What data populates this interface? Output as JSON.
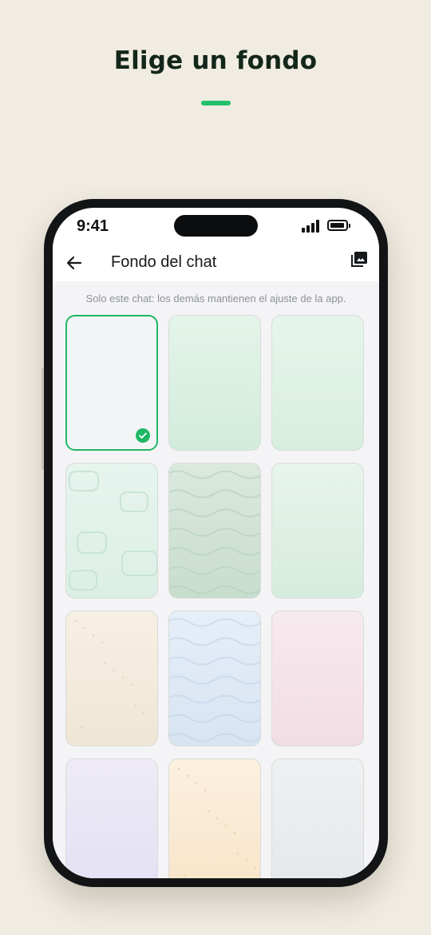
{
  "page": {
    "headline": "Elige un fondo",
    "accent_color": "#22c06b"
  },
  "status_bar": {
    "time": "9:41",
    "signal_icon": "signal-bars-icon",
    "battery_icon": "battery-icon"
  },
  "app_bar": {
    "back_icon": "back-arrow-icon",
    "title": "Fondo del chat",
    "gallery_icon": "photo-library-icon"
  },
  "hint": "Solo este chat: los demás mantienen el ajuste de la app.",
  "wallpapers": [
    {
      "id": "default",
      "style": "plain",
      "selected": true,
      "colors": [
        "#f3f4f6",
        "#f3f4f6"
      ]
    },
    {
      "id": "mint-gradient",
      "style": "gradient",
      "selected": false,
      "colors": [
        "#e4f4ea",
        "#d2ecdc"
      ]
    },
    {
      "id": "mint-light",
      "style": "gradient",
      "selected": false,
      "colors": [
        "#e6f5ec",
        "#d8eedf"
      ]
    },
    {
      "id": "mint-bubbles",
      "style": "bubbles",
      "selected": false,
      "colors": [
        "#e6f4ee",
        "#dcefe5"
      ]
    },
    {
      "id": "sage-waves",
      "style": "waves",
      "selected": false,
      "colors": [
        "#dbe9df",
        "#c8ddcd"
      ]
    },
    {
      "id": "mint-soft",
      "style": "gradient",
      "selected": false,
      "colors": [
        "#e7f4ec",
        "#d6ecdd"
      ]
    },
    {
      "id": "sand-dots",
      "style": "dots",
      "selected": false,
      "colors": [
        "#f7efe4",
        "#f0e6d6"
      ]
    },
    {
      "id": "sky-waves",
      "style": "waves",
      "selected": false,
      "colors": [
        "#e6eef8",
        "#d7e4f2"
      ]
    },
    {
      "id": "blush",
      "style": "gradient",
      "selected": false,
      "colors": [
        "#f7eaee",
        "#f1dde3"
      ]
    },
    {
      "id": "lavender",
      "style": "gradient",
      "selected": false,
      "colors": [
        "#eeebf6",
        "#e3e0f3"
      ]
    },
    {
      "id": "peach-dots",
      "style": "dots",
      "selected": false,
      "colors": [
        "#fcf0e0",
        "#f8e4c8"
      ]
    },
    {
      "id": "gray",
      "style": "gradient",
      "selected": false,
      "colors": [
        "#eef0f2",
        "#e5e8ea"
      ]
    }
  ],
  "selected_icon": "checkmark-icon"
}
